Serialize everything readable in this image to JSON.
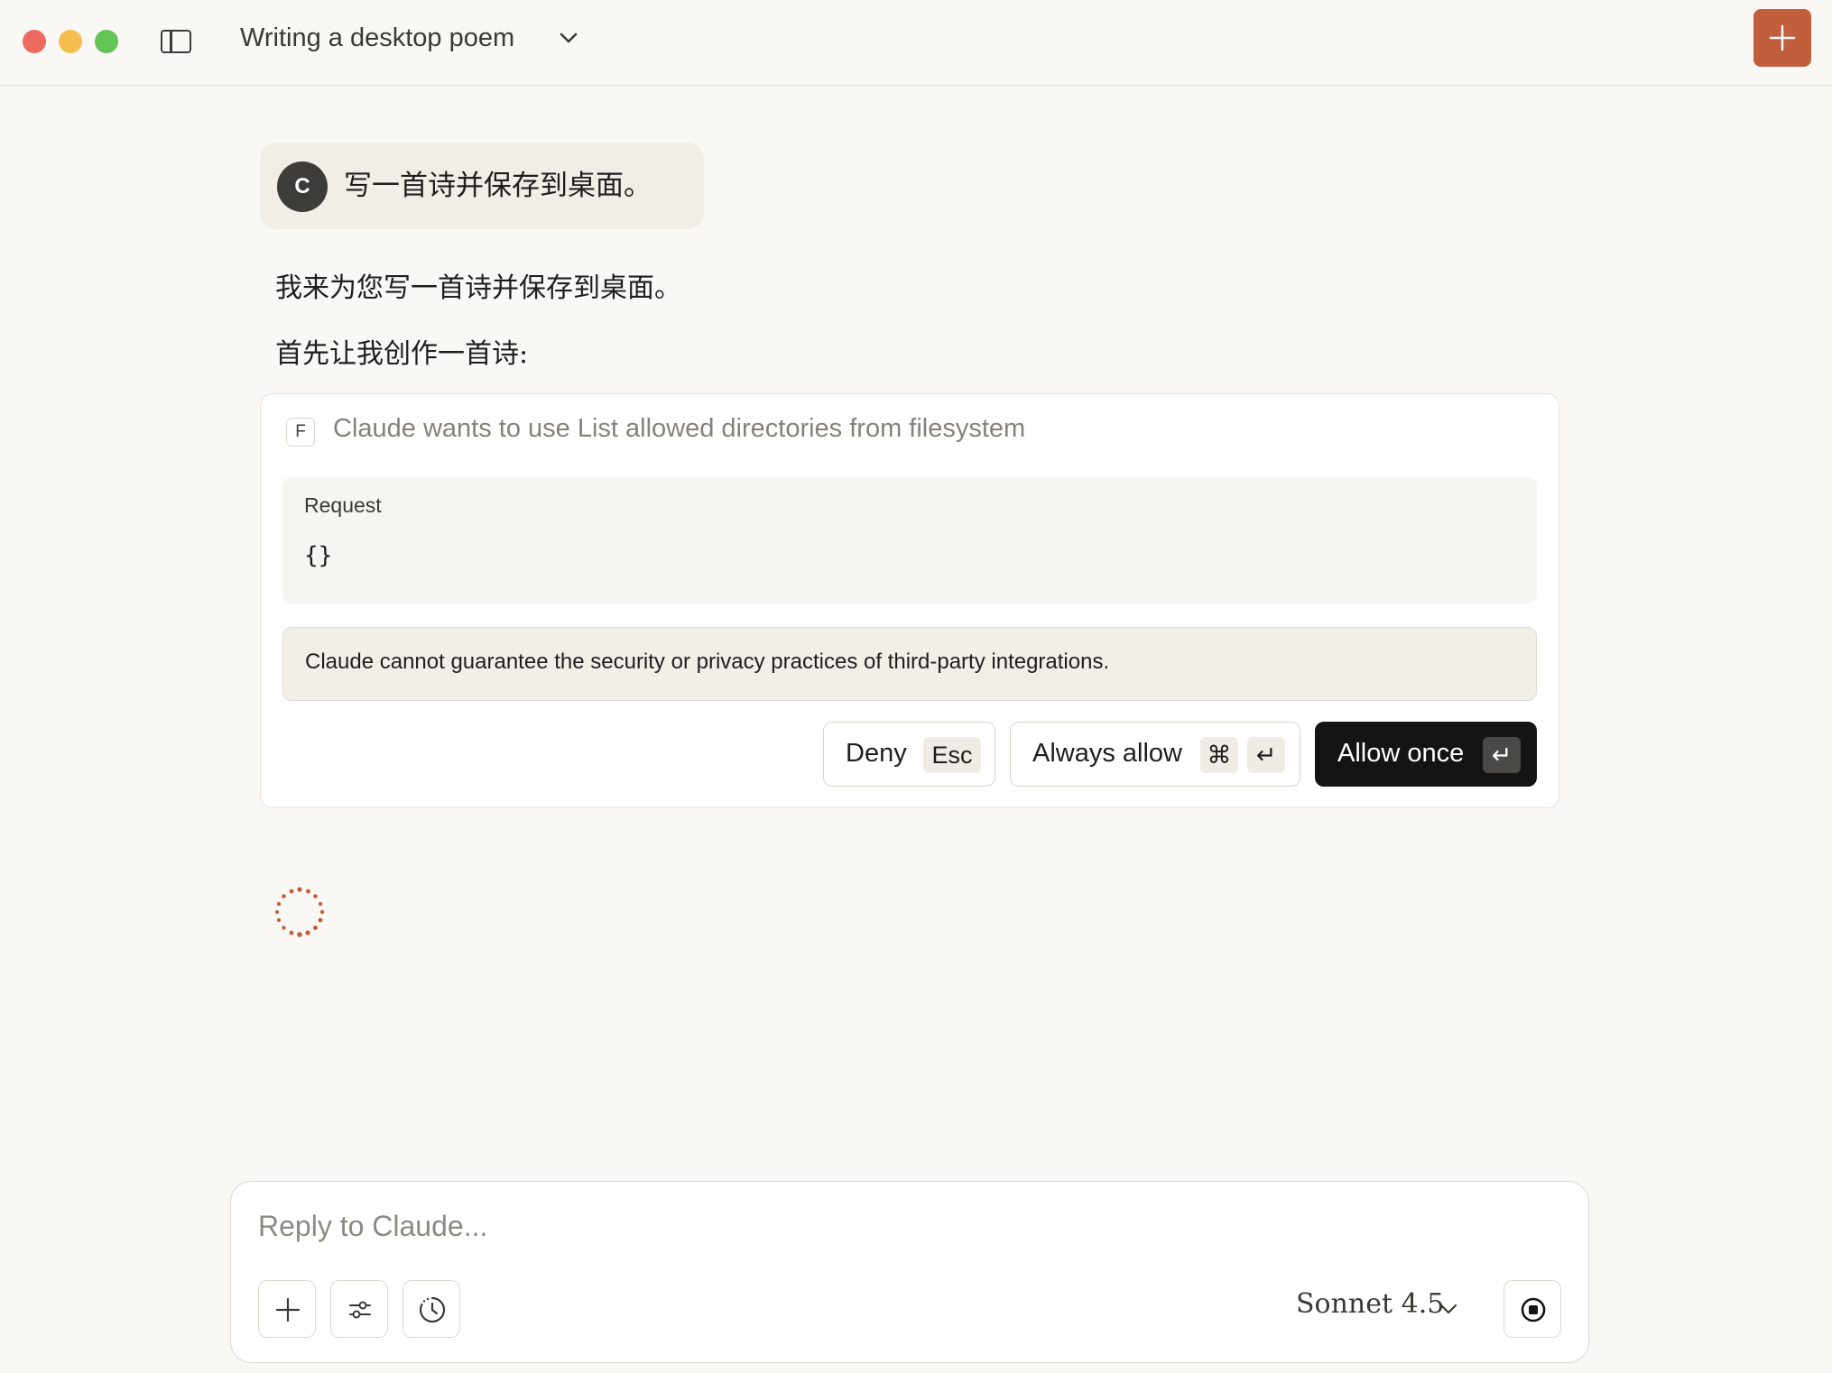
{
  "window": {
    "title": "Writing a desktop poem"
  },
  "icons": {
    "sidebar_toggle": "sidebar-icon",
    "title_menu": "chevron-down-icon",
    "new_chat": "plus-icon",
    "attach": "plus-icon",
    "options": "sliders-icon",
    "history": "clock-icon",
    "model_menu": "chevron-down-icon",
    "stop": "stop-icon",
    "spinner": "loading-spinner-icon"
  },
  "colors": {
    "accent": "#c15f3c",
    "background": "#f9f8f5",
    "allow_button": "#141413"
  },
  "user_message": {
    "avatar_initial": "C",
    "text": "写一首诗并保存到桌面。"
  },
  "assistant": {
    "line1": "我来为您写一首诗并保存到桌面。",
    "line2": "首先让我创作一首诗:"
  },
  "permission": {
    "badge": "F",
    "title": "Claude wants to use List allowed directories from filesystem",
    "request_label": "Request",
    "request_body": "{}",
    "warning": "Claude cannot guarantee the security or privacy practices of third-party integrations.",
    "deny_label": "Deny",
    "deny_shortcut": "Esc",
    "always_label": "Always allow",
    "always_shortcut_1": "⌘",
    "always_shortcut_2": "↵",
    "allow_label": "Allow once",
    "allow_shortcut": "↵"
  },
  "composer": {
    "placeholder": "Reply to Claude...",
    "value": "",
    "model": "Sonnet 4.5"
  }
}
